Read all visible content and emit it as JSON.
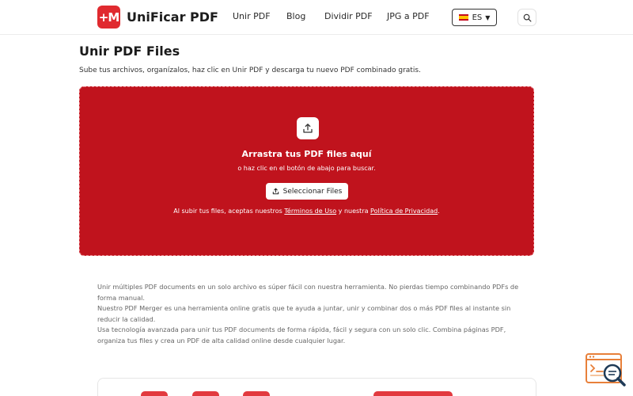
{
  "header": {
    "logo_mark": "+M",
    "brand": "UniFicar PDF",
    "nav": [
      "Unir PDF",
      "Blog",
      "Dividir PDF",
      "JPG a PDF"
    ],
    "language": "ES"
  },
  "main": {
    "title": "Unir PDF Files",
    "subtitle": "Sube tus archivos, organízalos, haz clic en Unir PDF y descarga tu nuevo PDF combinado gratis."
  },
  "dropzone": {
    "title": "Arrastra tus PDF files aquí",
    "subtitle": "o haz clic en el botón de abajo para buscar.",
    "button_label": "Seleccionar Files",
    "terms_prefix": "Al subir tus files, aceptas nuestros ",
    "terms_link": "Términos de Uso",
    "terms_middle": " y nuestra ",
    "privacy_link": "Política de Privacidad",
    "terms_suffix": "."
  },
  "description": [
    "Unir múltiples PDF documents en un solo archivo es súper fácil con nuestra herramienta. No pierdas tiempo combinando PDFs de forma manual.",
    "Nuestro PDF Merger es una herramienta online gratis que te ayuda a juntar, unir y combinar dos o más PDF files al instante sin reducir la calidad.",
    "Usa tecnología avanzada para unir tus PDF documents de forma rápida, fácil y segura con un solo clic. Combina páginas PDF, organiza tus files y crea un PDF de alta calidad online desde cualquier lugar."
  ],
  "colors": {
    "brand_red": "#e02a2f",
    "dropzone_red": "#c0131d"
  },
  "icons": {
    "upload": "upload-icon",
    "search": "search-icon",
    "flag": "spain-flag-icon"
  }
}
